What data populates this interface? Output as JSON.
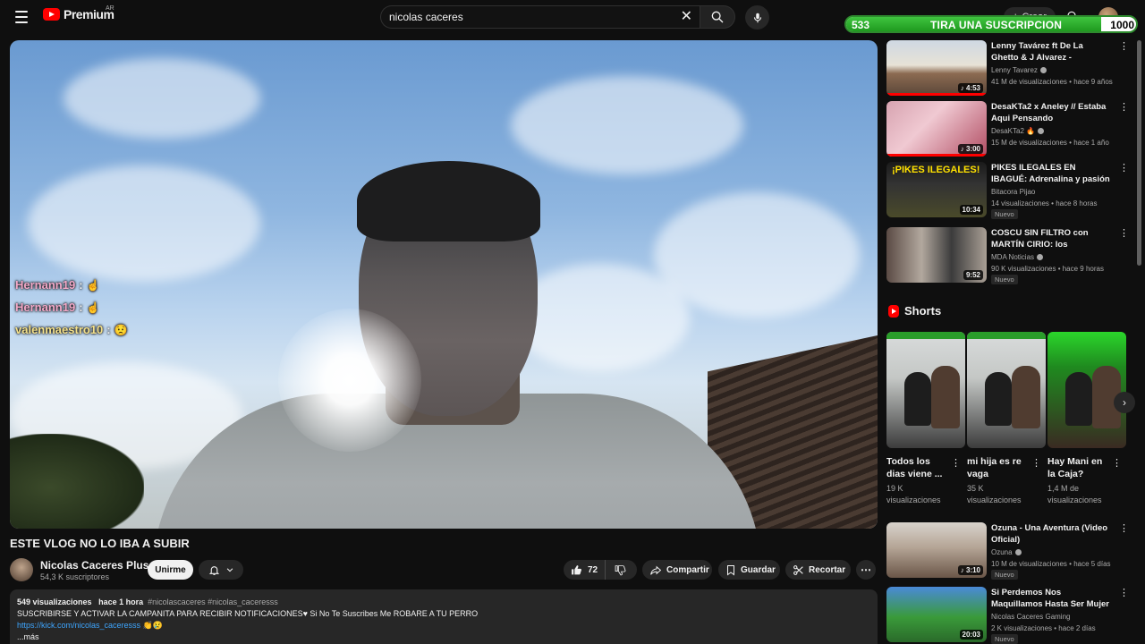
{
  "header": {
    "logo_text": "Premium",
    "logo_region": "AR",
    "search_value": "nicolas caceres",
    "create_label": "Crear"
  },
  "sub_goal": {
    "start": "533",
    "label": "TIRA UNA SUSCRIPCION",
    "end": "1000",
    "progress": 0.88,
    "color": "#2e8b2e"
  },
  "chat": [
    {
      "name": "Hernann19",
      "sep": ":",
      "emoji": "☝",
      "color": "#f3a9c8"
    },
    {
      "name": "Hernann19",
      "sep": ":",
      "emoji": "☝",
      "color": "#f3a9c8"
    },
    {
      "name": "valenmaestro10",
      "sep": ":",
      "emoji": "😟",
      "color": "#f3e08a"
    }
  ],
  "video": {
    "title": "ESTE VLOG NO LO IBA A SUBIR",
    "channel": "Nicolas Caceres Plus",
    "subs": "54,3 K suscriptores",
    "join_label": "Unirme",
    "likes": "72",
    "share_label": "Compartir",
    "save_label": "Guardar",
    "clip_label": "Recortar"
  },
  "description": {
    "views": "549 visualizaciones",
    "time": "hace 1 hora",
    "tags": "#nicolascaceres #nicolas_caceresss",
    "text": "SUSCRIBIRSE Y ACTIVAR LA CAMPANITA PARA RECIBIR NOTIFICACIONES♥  Si No Te Suscribes Me ROBARE A TU PERRO",
    "link": "https://kick.com/nicolas_caceresss",
    "link_emoji": "👏😢",
    "more": "...más"
  },
  "recommendations": [
    {
      "title": "Lenny Tavárez ft De La Ghetto & J Alvarez - Fantasías Remix ...",
      "channel": "Lenny Tavarez",
      "views": "41 M de visualizaciones",
      "age": "hace 9 años",
      "duration": "♪ 4:53",
      "badge": ""
    },
    {
      "title": "DesaKTa2 x Aneley // Estaba Aqui Pensando",
      "channel": "DesaKTa2 🔥",
      "views": "15 M de visualizaciones",
      "age": "hace 1 año",
      "duration": "♪ 3:00",
      "badge": ""
    },
    {
      "title": "PIKES ILEGALES EN IBAGUÉ: Adrenalina y pasión 🏍🔥",
      "channel": "Bitacora Pijao",
      "views": "14 visualizaciones",
      "age": "hace 8 horas",
      "duration": "10:34",
      "badge": "Nuevo"
    },
    {
      "title": "COSCU SIN FILTRO con MARTÍN CIRIO: los POLÉMICOS CA ...",
      "channel": "MDA Noticias",
      "views": "90 K visualizaciones",
      "age": "hace 9 horas",
      "duration": "9:52",
      "badge": "Nuevo"
    },
    {
      "title": "Ozuna - Una Aventura (Video Oficial)",
      "channel": "Ozuna",
      "views": "10 M de visualizaciones",
      "age": "hace 5 días",
      "duration": "♪ 3:10",
      "badge": "Nuevo"
    },
    {
      "title": "Si Perdemos Nos Maquillamos Hasta Ser Mujer",
      "channel": "Nicolas Caceres Gaming",
      "views": "2 K visualizaciones",
      "age": "hace 2 días",
      "duration": "20:03",
      "badge": "Nuevo"
    }
  ],
  "shorts": {
    "heading": "Shorts",
    "items": [
      {
        "title": "Todos los dias viene ...",
        "views": "19 K visualizaciones"
      },
      {
        "title": "mi hija es re vaga",
        "views": "35 K visualizaciones"
      },
      {
        "title": "Hay Mani en la Caja?",
        "views": "1,4 M de visualizaciones"
      }
    ]
  },
  "colors": {
    "background": "#0f0f0f",
    "surface": "#272727",
    "brand_red": "#ff0000",
    "link": "#3ea6ff"
  }
}
